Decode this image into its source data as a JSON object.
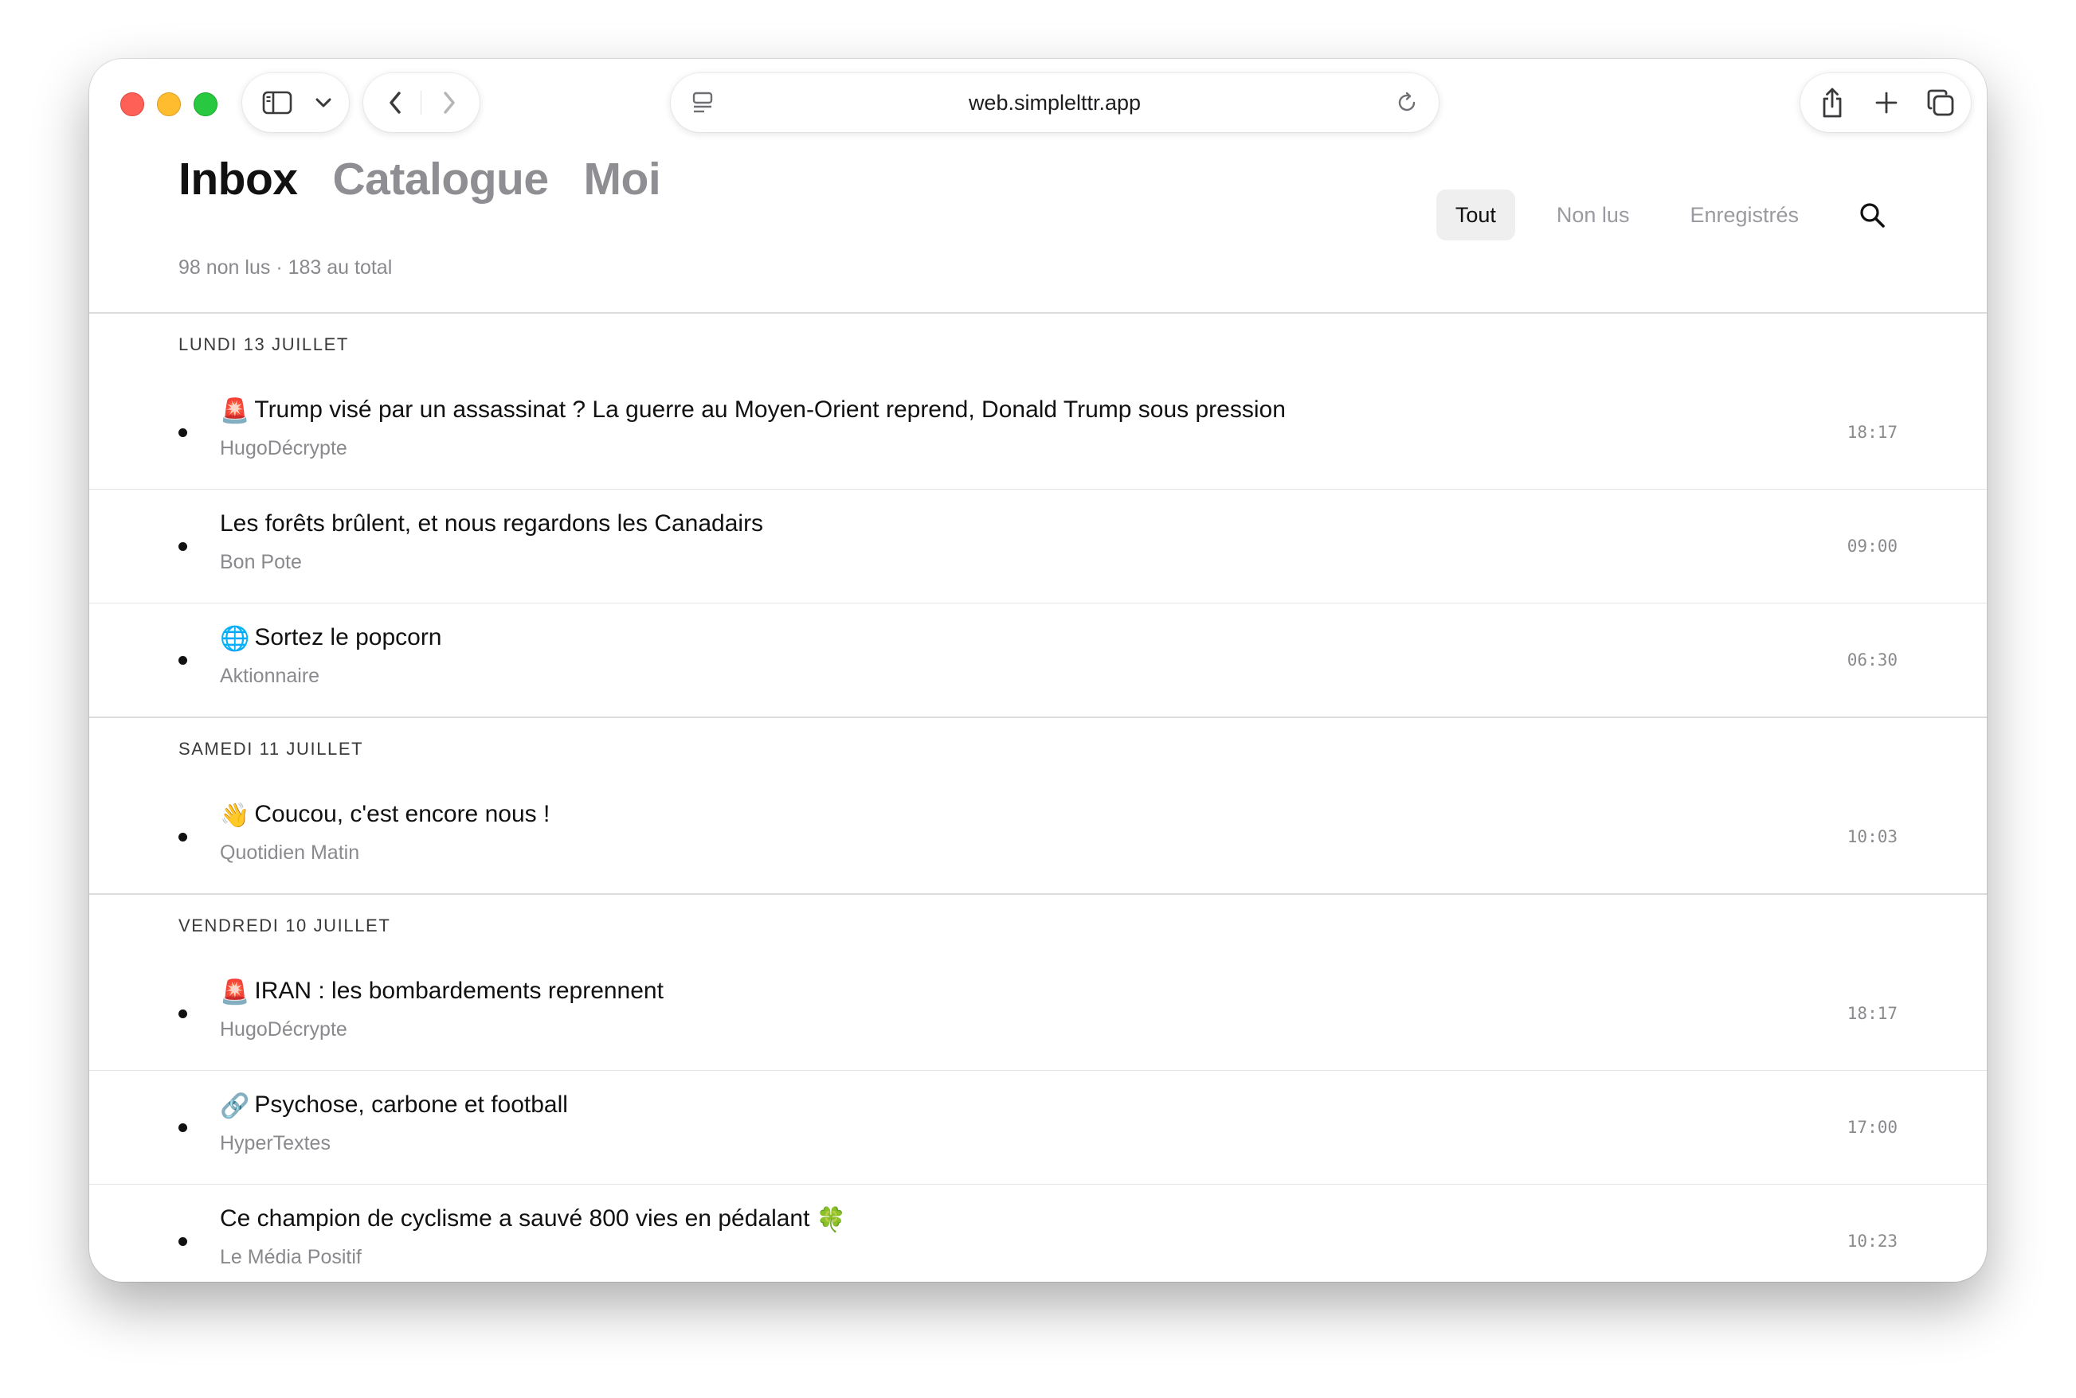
{
  "browser": {
    "url": "web.simplelttr.app",
    "colors": {
      "close": "#fe5f57",
      "minimize": "#febc2e",
      "zoom": "#28c840"
    }
  },
  "header": {
    "tabs": [
      {
        "label": "Inbox",
        "active": true
      },
      {
        "label": "Catalogue",
        "active": false
      },
      {
        "label": "Moi",
        "active": false
      }
    ],
    "subtitle": "98 non lus · 183 au total",
    "filters": [
      {
        "label": "Tout",
        "active": true
      },
      {
        "label": "Non lus",
        "active": false
      },
      {
        "label": "Enregistrés",
        "active": false
      }
    ]
  },
  "groups": [
    {
      "label": "Lundi 13 juillet",
      "items": [
        {
          "emoji": "🚨",
          "emoji_position": "before",
          "title": "Trump visé par un assassinat ? La guerre au Moyen-Orient reprend, Donald Trump sous pression",
          "source": "HugoDécrypte",
          "time": "18:17"
        },
        {
          "emoji": "",
          "emoji_position": "none",
          "title": "Les forêts brûlent, et nous regardons les Canadairs",
          "source": "Bon Pote",
          "time": "09:00"
        },
        {
          "emoji": "🌐",
          "emoji_position": "before",
          "title": "Sortez le popcorn",
          "source": "Aktionnaire",
          "time": "06:30"
        }
      ]
    },
    {
      "label": "Samedi 11 juillet",
      "items": [
        {
          "emoji": "👋",
          "emoji_position": "before",
          "title": "Coucou, c'est encore nous !",
          "source": "Quotidien Matin",
          "time": "10:03"
        }
      ]
    },
    {
      "label": "Vendredi 10 juillet",
      "items": [
        {
          "emoji": "🚨",
          "emoji_position": "before",
          "title": "IRAN : les bombardements reprennent",
          "source": "HugoDécrypte",
          "time": "18:17"
        },
        {
          "emoji": "🔗",
          "emoji_position": "before",
          "title": "Psychose, carbone et football",
          "source": "HyperTextes",
          "time": "17:00"
        },
        {
          "emoji": "🍀",
          "emoji_position": "after",
          "title": "Ce champion de cyclisme a sauvé 800 vies en pédalant",
          "source": "Le Média Positif",
          "time": "10:23"
        }
      ]
    }
  ]
}
